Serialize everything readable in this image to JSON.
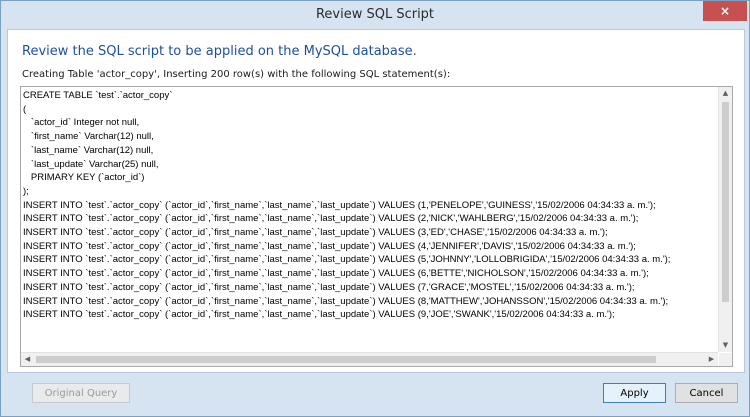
{
  "window": {
    "title": "Review SQL Script",
    "close_icon": "×"
  },
  "main": {
    "heading": "Review the SQL script to be applied on the MySQL database.",
    "subheading": "Creating Table 'actor_copy', Inserting 200 row(s) with the following SQL statement(s):"
  },
  "editor": {
    "sql_script": "CREATE TABLE `test`.`actor_copy`\n(\n   `actor_id` Integer not null,\n   `first_name` Varchar(12) null,\n   `last_name` Varchar(12) null,\n   `last_update` Varchar(25) null,\n   PRIMARY KEY (`actor_id`)\n);\nINSERT INTO `test`.`actor_copy` (`actor_id`,`first_name`,`last_name`,`last_update`) VALUES (1,'PENELOPE','GUINESS','15/02/2006 04:34:33 a. m.');\nINSERT INTO `test`.`actor_copy` (`actor_id`,`first_name`,`last_name`,`last_update`) VALUES (2,'NICK','WAHLBERG','15/02/2006 04:34:33 a. m.');\nINSERT INTO `test`.`actor_copy` (`actor_id`,`first_name`,`last_name`,`last_update`) VALUES (3,'ED','CHASE','15/02/2006 04:34:33 a. m.');\nINSERT INTO `test`.`actor_copy` (`actor_id`,`first_name`,`last_name`,`last_update`) VALUES (4,'JENNIFER','DAVIS','15/02/2006 04:34:33 a. m.');\nINSERT INTO `test`.`actor_copy` (`actor_id`,`first_name`,`last_name`,`last_update`) VALUES (5,'JOHNNY','LOLLOBRIGIDA','15/02/2006 04:34:33 a. m.');\nINSERT INTO `test`.`actor_copy` (`actor_id`,`first_name`,`last_name`,`last_update`) VALUES (6,'BETTE','NICHOLSON','15/02/2006 04:34:33 a. m.');\nINSERT INTO `test`.`actor_copy` (`actor_id`,`first_name`,`last_name`,`last_update`) VALUES (7,'GRACE','MOSTEL','15/02/2006 04:34:33 a. m.');\nINSERT INTO `test`.`actor_copy` (`actor_id`,`first_name`,`last_name`,`last_update`) VALUES (8,'MATTHEW','JOHANSSON','15/02/2006 04:34:33 a. m.');\nINSERT INTO `test`.`actor_copy` (`actor_id`,`first_name`,`last_name`,`last_update`) VALUES (9,'JOE','SWANK','15/02/2006 04:34:33 a. m.');"
  },
  "scroll_icons": {
    "up": "▲",
    "down": "▼",
    "left": "◀",
    "right": "▶"
  },
  "footer": {
    "original_query_label": "Original Query",
    "apply_label": "Apply",
    "cancel_label": "Cancel"
  }
}
